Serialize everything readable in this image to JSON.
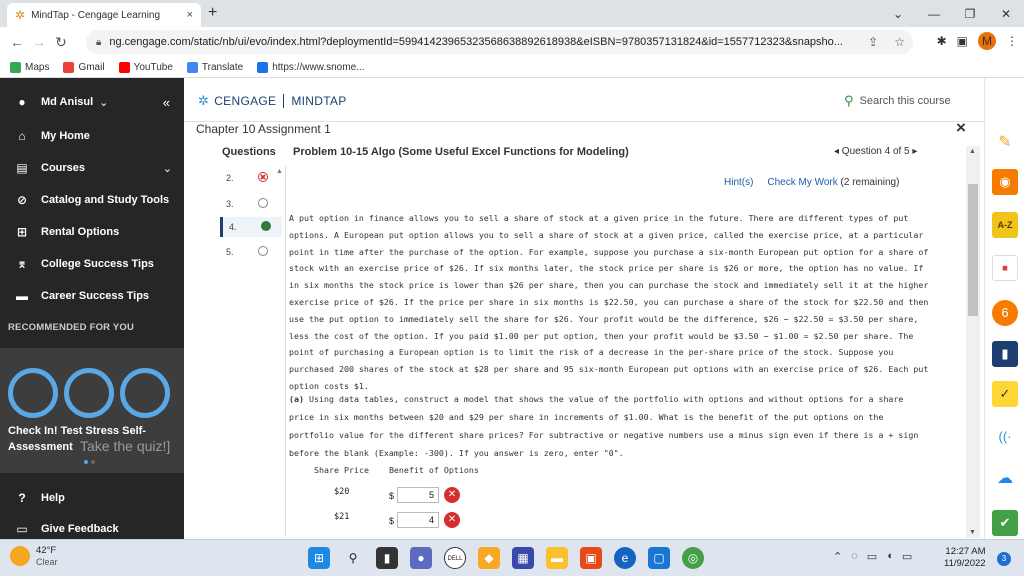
{
  "browser": {
    "tab_title": "MindTap - Cengage Learning",
    "tab_close": "×",
    "new_tab": "+",
    "url": "ng.cengage.com/static/nb/ui/evo/index.html?deploymentId=59941423965323568638892618938&eISBN=9780357131824&id=1557712323&snapsho...",
    "profile_initial": "M",
    "bookmarks": [
      {
        "label": "Maps",
        "color": "#34a853"
      },
      {
        "label": "Gmail",
        "color": "#ea4335"
      },
      {
        "label": "YouTube",
        "color": "#ff0000"
      },
      {
        "label": "Translate",
        "color": "#4285f4"
      },
      {
        "label": "https://www.snome...",
        "color": "#1a73e8"
      }
    ]
  },
  "sidebar": {
    "user_name": "Md Anisul",
    "items": [
      {
        "label": "My Home"
      },
      {
        "label": "Courses"
      },
      {
        "label": "Catalog and Study Tools"
      },
      {
        "label": "Rental Options"
      },
      {
        "label": "College Success Tips"
      },
      {
        "label": "Career Success Tips"
      }
    ],
    "recommended_heading": "RECOMMENDED FOR YOU",
    "promo_title": "Check In! Test Stress Self-Assessment",
    "promo_cta": "Take the quiz!]",
    "help_label": "Help",
    "feedback_label": "Give Feedback"
  },
  "header": {
    "brand_left": "CENGAGE",
    "brand_right": "MINDTAP",
    "search_label": "Search this course",
    "help_icon_text": "?"
  },
  "assignment": {
    "title": "Chapter 10 Assignment 1",
    "close": "×"
  },
  "question_panel": {
    "heading": "Questions",
    "items": [
      {
        "num": "2.",
        "status": "wrong"
      },
      {
        "num": "3.",
        "status": "unanswered"
      },
      {
        "num": "4.",
        "status": "current"
      },
      {
        "num": "5.",
        "status": "unanswered"
      }
    ]
  },
  "problem": {
    "title": "Problem 10-15 Algo (Some Useful Excel Functions for Modeling)",
    "nav_text": "◂ Question 4 of 5 ▸",
    "hint_link": "Hint(s)",
    "check_link": "Check My Work",
    "remaining": "(2 remaining)",
    "body": "A put option in finance allows you to sell a share of stock at a given price in the future. There are different types of put options. A European put option allows you to sell a share of stock at a given price, called the exercise price, at a particular point in time after the purchase of the option. For example, suppose you purchase a six-month European put option for a share of stock with an exercise price of $26. If six months later, the stock price per share is $26 or more, the option has no value. If in six months the stock price is lower than $26 per share, then you can purchase the stock and immediately sell it at the higher exercise price of $26. If the price per share in six months is $22.50, you can purchase a share of the stock for $22.50 and then use the put option to immediately sell the share for $26. Your profit would be the difference, $26 − $22.50 = $3.50 per share, less the cost of the option. If you paid $1.00 per put option, then your profit would be $3.50 − $1.00 = $2.50 per share. The point of purchasing a European option is to limit the risk of a decrease in the per-share price of the stock. Suppose you purchased 200 shares of the stock at $28 per share and 95 six-month European put options with an exercise price of $26. Each put option costs $1.",
    "part_a_label": "(a)",
    "part_a_text": "Using data tables, construct a model that shows the value of the portfolio with options and without options for a share price in six months between $20 and $29 per share in increments of $1.00. What is the benefit of the put options on the portfolio value for the different share prices? For subtractive or negative numbers use a minus sign even if there is a + sign before the blank (Example: -300). If you answer is zero, enter \"0\".",
    "table": {
      "headers": [
        "Share Price",
        "Benefit of Options"
      ],
      "currency": "$",
      "rows": [
        {
          "price": "$20",
          "value": "5",
          "status": "incorrect"
        },
        {
          "price": "$21",
          "value": "4",
          "status": "incorrect"
        }
      ]
    }
  },
  "taskbar": {
    "temperature": "42°F",
    "condition": "Clear",
    "time": "12:27 AM",
    "date": "11/9/2022",
    "notifications": "3"
  }
}
